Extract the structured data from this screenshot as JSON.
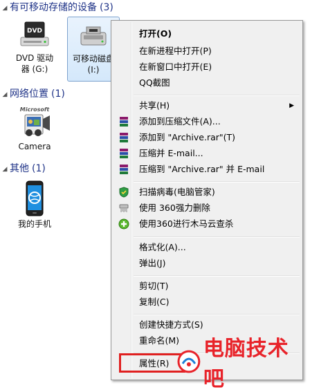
{
  "groups": [
    {
      "name": "有可移动存储的设备",
      "count": "(3)"
    },
    {
      "name": "网络位置",
      "count": "(1)"
    },
    {
      "name": "其他",
      "count": "(1)"
    }
  ],
  "items": {
    "dvd": {
      "label_line1": "DVD 驱动",
      "label_line2": "器 (G:)",
      "icon_text": "DVD"
    },
    "removable": {
      "label_line1": "可移动磁盘",
      "label_line2": "(I:)"
    },
    "camera": {
      "label": "Camera",
      "icon_text": "Microsoft"
    },
    "phone": {
      "label": "我的手机"
    }
  },
  "menu": {
    "open": "打开(O)",
    "open_new_process": "在新进程中打开(P)",
    "open_new_window": "在新窗口中打开(E)",
    "qq_screenshot": "QQ截图",
    "share": "共享(H)",
    "add_to_archive": "添加到压缩文件(A)...",
    "add_to_archive_rar": "添加到 \"Archive.rar\"(T)",
    "compress_email": "压缩并 E-mail...",
    "compress_rar_email": "压缩到 \"Archive.rar\" 并 E-mail",
    "scan_virus": "扫描病毒(电脑管家)",
    "force_delete": "使用 360强力删除",
    "trojan_scan": "使用360进行木马云查杀",
    "format": "格式化(A)...",
    "eject": "弹出(J)",
    "cut": "剪切(T)",
    "copy": "复制(C)",
    "create_shortcut": "创建快捷方式(S)",
    "rename": "重命名(M)",
    "properties": "属性(R)"
  },
  "watermark": {
    "text": "电脑技术吧"
  },
  "colors": {
    "accent_header": "#1e3287",
    "highlight": "#e02020",
    "watermark": "#e8232a"
  }
}
